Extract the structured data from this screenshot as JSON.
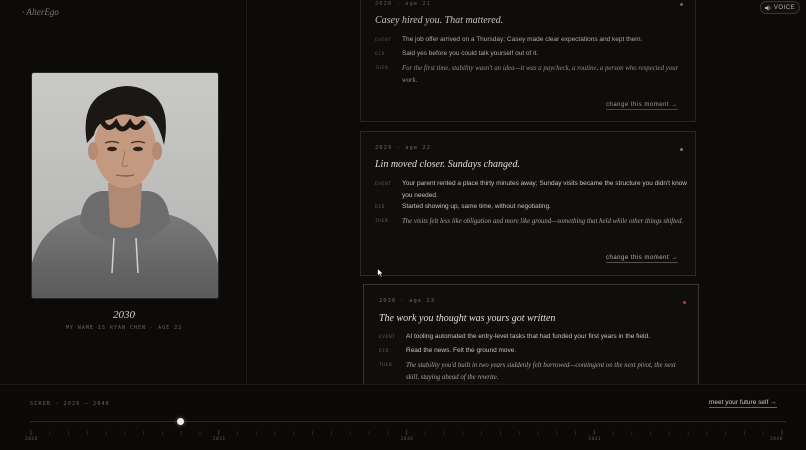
{
  "app": {
    "brand": "· AlterEgo",
    "voice_label": "VOICE"
  },
  "profile": {
    "year": "2030",
    "caption": "MY NAME IS RYAN CHEN · AGE 22"
  },
  "cards": [
    {
      "meta": "2028 · age 21",
      "title": "Casey hired you. That mattered.",
      "rows": [
        {
          "key": "EVENT",
          "text": "The job offer arrived on a Thursday; Casey made clear expectations and kept them."
        },
        {
          "key": "DID",
          "text": "Said yes before you could talk yourself out of it."
        },
        {
          "key": "THEN",
          "text": "For the first time, stability wasn't an idea—it was a paycheck, a routine, a person who respected your work."
        }
      ],
      "link": "change this moment →"
    },
    {
      "meta": "2029 · age 22",
      "title": "Lin moved closer. Sundays changed.",
      "rows": [
        {
          "key": "EVENT",
          "text": "Your parent rented a place thirty minutes away; Sunday visits became the structure you didn't know you needed."
        },
        {
          "key": "DID",
          "text": "Started showing up, same time, without negotiating."
        },
        {
          "key": "THEN",
          "text": "The visits felt less like obligation and more like ground—something that held while other things shifted."
        }
      ],
      "link": "change this moment →"
    },
    {
      "meta": "2030 · age 23",
      "title": "The work you thought was yours got written",
      "rows": [
        {
          "key": "EVENT",
          "text": "AI tooling automated the entry-level tasks that had funded your first years in the field."
        },
        {
          "key": "DID",
          "text": "Read the news. Felt the ground move."
        },
        {
          "key": "THEN",
          "text": "The stability you'd built in two years suddenly felt borrowed—contingent on the next pivot, the next skill, staying ahead of the rewrite."
        }
      ]
    }
  ],
  "scrubber": {
    "label": "SCRUB · 2026 – 2046",
    "meet_label": "meet your future self →",
    "value_fraction": 0.2,
    "tick_labels": [
      "2026",
      "2031",
      "2036",
      "2041",
      "2046"
    ]
  },
  "colors": {
    "accent_red": "#c0392b",
    "background": "#0c0b0a"
  },
  "icons": {
    "voice": "speaker-icon",
    "cursor": "mouse-pointer-icon"
  }
}
